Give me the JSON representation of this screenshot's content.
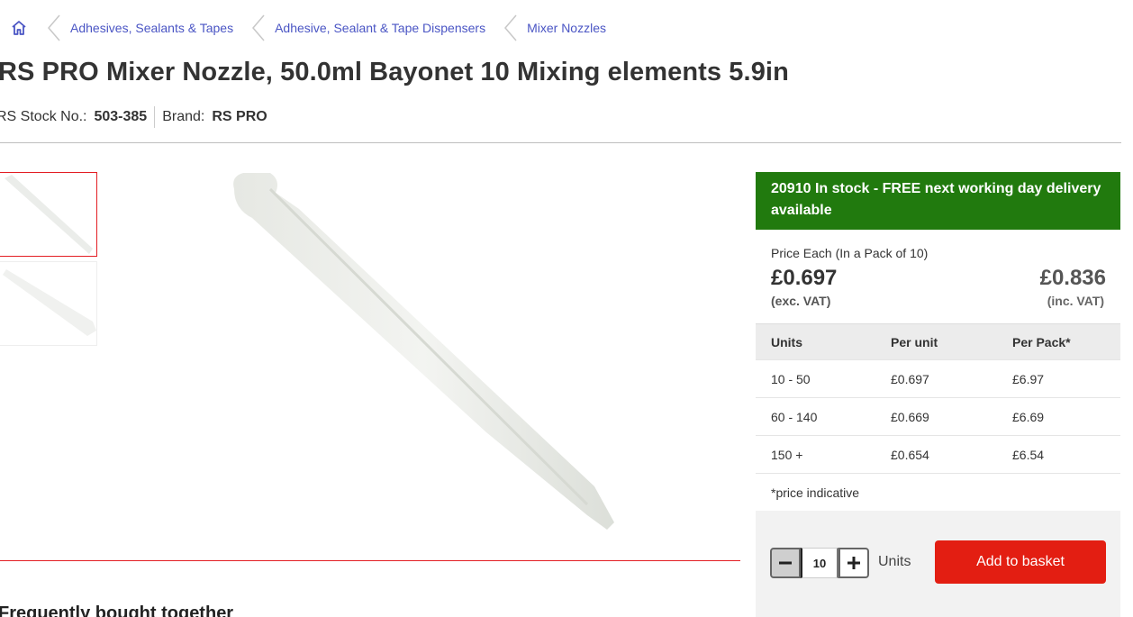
{
  "breadcrumb": {
    "home_icon": "home-icon",
    "items": [
      {
        "label": "Adhesives, Sealants & Tapes"
      },
      {
        "label": "Adhesive, Sealant & Tape Dispensers"
      },
      {
        "label": "Mixer Nozzles"
      }
    ]
  },
  "product": {
    "title": "RS PRO Mixer Nozzle, 50.0ml Bayonet 10 Mixing elements 5.9in",
    "stock_no_label": "RS Stock No.:",
    "stock_no": "503-385",
    "brand_label": "Brand:",
    "brand": "RS PRO"
  },
  "stock": {
    "message": "20910 In stock - FREE next working day delivery available"
  },
  "price": {
    "caption": "Price Each (In a Pack of 10)",
    "exc_vat": "£0.697",
    "exc_vat_label": "(exc. VAT)",
    "inc_vat": "£0.836",
    "inc_vat_label": "(inc. VAT)"
  },
  "tiers": {
    "headers": {
      "units": "Units",
      "per_unit": "Per unit",
      "per_pack": "Per Pack*"
    },
    "rows": [
      {
        "units": "10 - 50",
        "per_unit": "£0.697",
        "per_pack": "£6.97"
      },
      {
        "units": "60 - 140",
        "per_unit": "£0.669",
        "per_pack": "£6.69"
      },
      {
        "units": "150 +",
        "per_unit": "£0.654",
        "per_pack": "£6.54"
      }
    ],
    "note": "*price indicative"
  },
  "quantity": {
    "value": "10",
    "units_label": "Units",
    "minus_icon": "minus-icon",
    "plus_icon": "plus-icon"
  },
  "add_to_basket_label": "Add to basket",
  "frequently_bought": {
    "heading": "Frequently bought together"
  },
  "colors": {
    "stock_green": "#217a0e",
    "brand_red": "#e31e12",
    "link_blue": "#4a55c4"
  }
}
